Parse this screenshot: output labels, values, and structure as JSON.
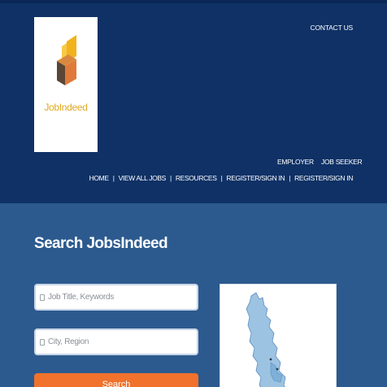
{
  "header": {
    "logo_text": "JobIndeed",
    "contact_label": "CONTACT US",
    "sub_nav": {
      "employer_label": "EMPLOYER",
      "job_seeker_label": "JOB SEEKER"
    },
    "main_nav": {
      "home_label": "HOME",
      "view_all_jobs_label": "VIEW ALL JOBS",
      "resources_label": "RESOURCES",
      "register_employer_label": "REGISTER/SIGN IN",
      "register_seeker_label": "REGISTER/SIGN IN",
      "separator": "|"
    }
  },
  "search": {
    "title": "Search JobsIndeed",
    "keywords_placeholder": "Job Title, Keywords",
    "region_placeholder": "City, Region",
    "button_label": "Search"
  },
  "colors": {
    "header_bg": "#0f3166",
    "body_bg": "#2c5a8e",
    "button_bg": "#f0722c",
    "logo_text": "#e0a820"
  }
}
